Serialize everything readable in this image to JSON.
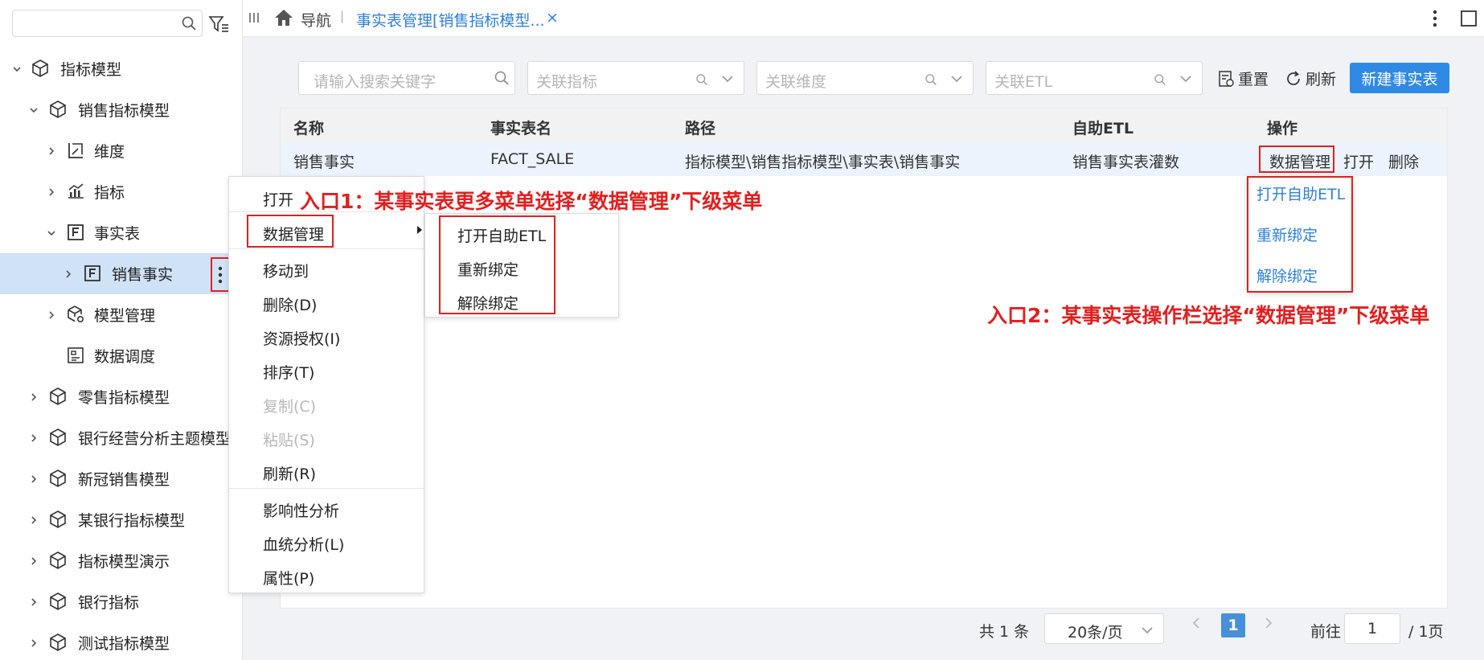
{
  "sidebar": {
    "search_placeholder": "",
    "tree": [
      {
        "label": "指标模型",
        "icon": "cube-icon",
        "expanded": true
      },
      {
        "label": "销售指标模型",
        "icon": "cube-icon",
        "expanded": true
      },
      {
        "label": "维度",
        "icon": "dimension-icon"
      },
      {
        "label": "指标",
        "icon": "metric-chart-icon"
      },
      {
        "label": "事实表",
        "icon": "fact-table-icon",
        "expanded": true
      },
      {
        "label": "销售事实",
        "icon": "fact-table-icon",
        "selected": true
      },
      {
        "label": "模型管理",
        "icon": "model-manage-icon"
      },
      {
        "label": "数据调度",
        "icon": "schedule-icon"
      },
      {
        "label": "零售指标模型",
        "icon": "cube-icon"
      },
      {
        "label": "银行经营分析主题模型",
        "icon": "cube-icon"
      },
      {
        "label": "新冠销售模型",
        "icon": "cube-icon"
      },
      {
        "label": "某银行指标模型",
        "icon": "cube-icon"
      },
      {
        "label": "指标模型演示",
        "icon": "cube-icon"
      },
      {
        "label": "银行指标",
        "icon": "cube-icon"
      },
      {
        "label": "测试指标模型",
        "icon": "cube-icon"
      }
    ]
  },
  "topbar": {
    "nav_label": "导航",
    "separator": "|",
    "tab_label": "事实表管理[销售指标模型...",
    "close": "×"
  },
  "filters": {
    "search_placeholder": "请输入搜索关键字",
    "metric_placeholder": "关联指标",
    "dimension_placeholder": "关联维度",
    "etl_placeholder": "关联ETL",
    "reset_label": "重置",
    "refresh_label": "刷新",
    "new_label": "新建事实表"
  },
  "table": {
    "headers": [
      "名称",
      "事实表名",
      "路径",
      "自助ETL",
      "操作"
    ],
    "rows": [
      {
        "name": "销售事实",
        "table_name": "FACT_SALE",
        "path": "指标模型\\销售指标模型\\事实表\\销售事实",
        "etl": "销售事实表灌数",
        "op_data": "数据管理",
        "op_open": "打开",
        "op_delete": "删除"
      }
    ]
  },
  "pagination": {
    "total": "共 1 条",
    "page_size": "20条/页",
    "current": "1",
    "goto_label": "前往",
    "goto_value": "1",
    "pages": "/ 1页"
  },
  "context_menu": {
    "items": [
      "打开",
      "数据管理",
      "移动到",
      "删除(D)",
      "资源授权(I)",
      "排序(T)",
      "复制(C)",
      "粘贴(S)",
      "刷新(R)",
      "影响性分析",
      "血统分析(L)",
      "属性(P)"
    ],
    "disabled": [
      "复制(C)",
      "粘贴(S)"
    ]
  },
  "data_submenu": {
    "items": [
      "打开自助ETL",
      "重新绑定",
      "解除绑定"
    ]
  },
  "ops_submenu": {
    "items": [
      "打开自助ETL",
      "重新绑定",
      "解除绑定"
    ]
  },
  "annotations": {
    "entry1": "入口1：某事实表更多菜单选择“数据管理”下级菜单",
    "entry2": "入口2：某事实表操作栏选择“数据管理”下级菜单"
  },
  "colors": {
    "accent": "#2f8ae5",
    "link": "#2f7fd8",
    "highlight_border": "#e02020",
    "selected_row": "#cfe2f6"
  }
}
